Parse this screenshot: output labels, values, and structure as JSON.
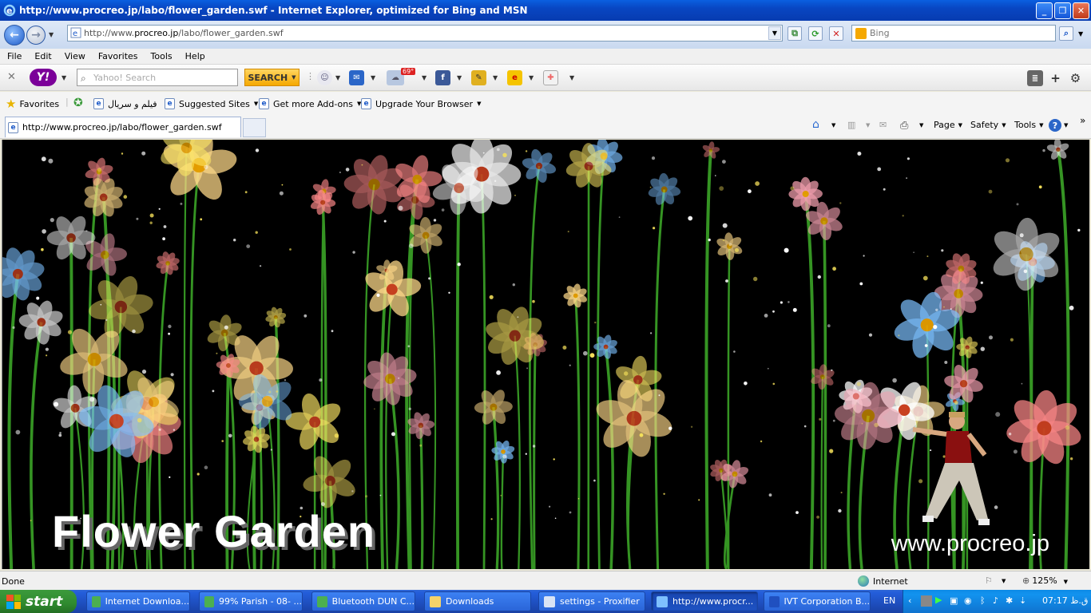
{
  "window": {
    "title": "http://www.procreo.jp/labo/flower_garden.swf - Internet Explorer, optimized for Bing and MSN",
    "minimize_icon": "minimize-icon",
    "maximize_icon": "restore-icon",
    "close_icon": "close-icon"
  },
  "address": {
    "prefix": "http://www.",
    "host": "procreo.jp",
    "path": "/labo/flower_garden.swf",
    "search_placeholder": "Bing"
  },
  "menu": [
    "File",
    "Edit",
    "View",
    "Favorites",
    "Tools",
    "Help"
  ],
  "yahoo_toolbar": {
    "logo": "Y!",
    "search_placeholder": "Yahoo! Search",
    "search_button": "SEARCH",
    "weather_temp": "69°"
  },
  "favorites_bar": {
    "favorites_label": "Favorites",
    "items": [
      "فيلم و سريال",
      "Suggested Sites",
      "Get more Add-ons",
      "Upgrade Your Browser"
    ]
  },
  "tabs": {
    "active_tab": "http://www.procreo.jp/labo/flower_garden.swf"
  },
  "command_bar": {
    "page": "Page",
    "safety": "Safety",
    "tools": "Tools"
  },
  "content": {
    "title": "Flower Garden",
    "url": "www.procreo.jp"
  },
  "status": {
    "text": "Done",
    "zone": "Internet",
    "zoom": "125%"
  },
  "taskbar": {
    "start": "start",
    "tasks": [
      {
        "label": "Internet Downloa..."
      },
      {
        "label": "99% Parish - 08- ..."
      },
      {
        "label": "Bluetooth DUN C..."
      },
      {
        "label": "Downloads"
      },
      {
        "label": "settings - Proxifier"
      },
      {
        "label": "http://www.procr..."
      },
      {
        "label": "IVT Corporation B..."
      }
    ],
    "language": "EN",
    "clock": "07:17 ق.ظ"
  }
}
